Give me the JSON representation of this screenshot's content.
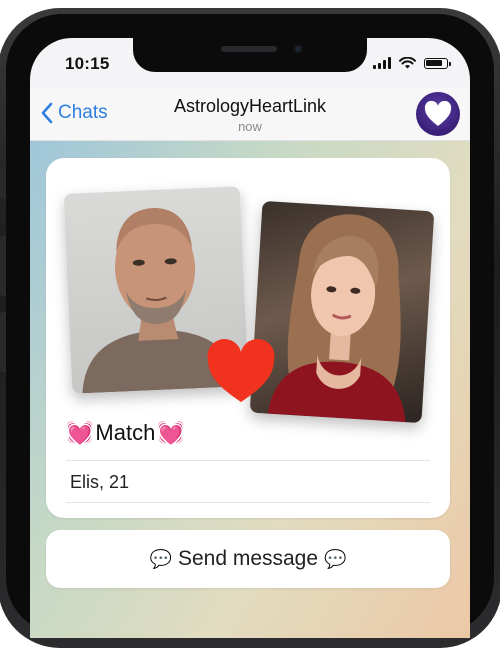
{
  "status_bar": {
    "time": "10:15"
  },
  "nav": {
    "back_label": "Chats",
    "title": "AstrologyHeartLink",
    "subtitle": "now"
  },
  "match_card": {
    "heading": "Match",
    "heading_emoji_left": "💓",
    "heading_emoji_right": "💓",
    "name_age": "Elis, 21"
  },
  "actions": {
    "send_message_label": "Send message",
    "send_message_emoji": "💬"
  },
  "icons": {
    "back": "chevron-left-icon",
    "avatar": "purple-heart-icon",
    "match_badge": "red-heart-icon",
    "signal": "cellular-signal-icon",
    "wifi": "wifi-icon",
    "battery": "battery-icon"
  },
  "colors": {
    "accent_blue": "#2f7fe0",
    "avatar_purple": "#4a2a8f",
    "heart_red": "#f0321e"
  }
}
